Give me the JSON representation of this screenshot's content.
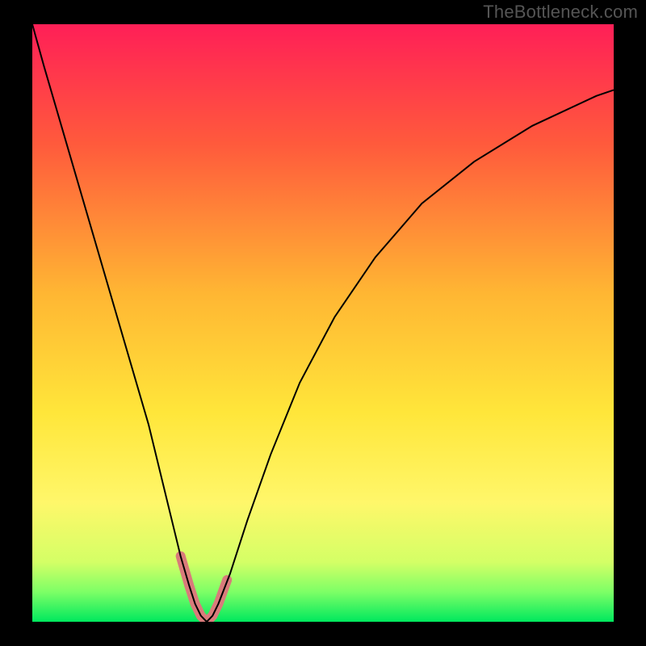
{
  "watermark": "TheBottleneck.com",
  "chart_data": {
    "type": "line",
    "title": "",
    "xlabel": "",
    "ylabel": "",
    "xlim": [
      0,
      100
    ],
    "ylim": [
      0,
      100
    ],
    "grid": false,
    "legend": null,
    "gradient_stops": [
      {
        "offset": 0.0,
        "color": "#ff1f57"
      },
      {
        "offset": 0.2,
        "color": "#ff5a3c"
      },
      {
        "offset": 0.45,
        "color": "#ffb633"
      },
      {
        "offset": 0.65,
        "color": "#ffe63a"
      },
      {
        "offset": 0.8,
        "color": "#fff76a"
      },
      {
        "offset": 0.9,
        "color": "#d4ff66"
      },
      {
        "offset": 0.95,
        "color": "#7dff66"
      },
      {
        "offset": 1.0,
        "color": "#00e85e"
      }
    ],
    "series": [
      {
        "name": "bottleneck-curve",
        "stroke": "#000000",
        "stroke_width": 2,
        "x": [
          0,
          2,
          5,
          8,
          11,
          14,
          17,
          20,
          22,
          24,
          25.5,
          27,
          28,
          29,
          30,
          31,
          32,
          34,
          37,
          41,
          46,
          52,
          59,
          67,
          76,
          86,
          97,
          100
        ],
        "y": [
          100,
          93,
          83,
          73,
          63,
          53,
          43,
          33,
          25,
          17,
          11,
          6,
          3,
          1,
          0,
          1,
          3,
          8,
          17,
          28,
          40,
          51,
          61,
          70,
          77,
          83,
          88,
          89
        ]
      },
      {
        "name": "valley-highlight",
        "stroke": "#d97b7b",
        "stroke_width": 12,
        "linecap": "round",
        "x": [
          25.5,
          27,
          28,
          29,
          30,
          31,
          32,
          33.5
        ],
        "y": [
          11,
          6,
          3,
          1,
          0,
          1,
          3,
          7
        ]
      }
    ]
  }
}
